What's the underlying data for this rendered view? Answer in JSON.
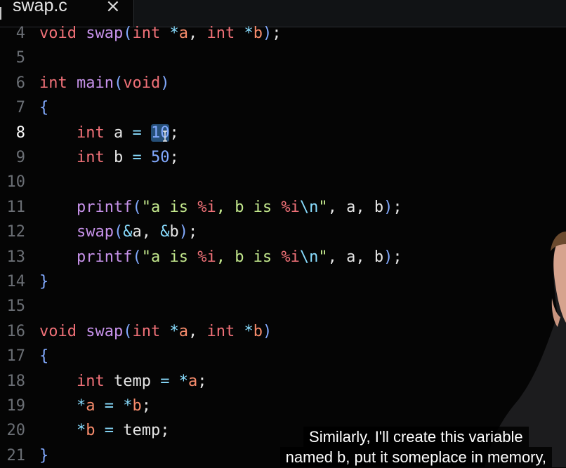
{
  "tab": {
    "label": "swap.c",
    "close_glyph": "×",
    "icon": "file-icon"
  },
  "active_line": "8",
  "lines": [
    {
      "n": "4",
      "tokens": [
        [
          "kw",
          "void"
        ],
        [
          "pl",
          " "
        ],
        [
          "fn",
          "swap"
        ],
        [
          "pn",
          "("
        ],
        [
          "kw",
          "int"
        ],
        [
          "pl",
          " "
        ],
        [
          "op",
          "*"
        ],
        [
          "vr",
          "a"
        ],
        [
          "pl",
          ", "
        ],
        [
          "kw",
          "int"
        ],
        [
          "pl",
          " "
        ],
        [
          "op",
          "*"
        ],
        [
          "vr",
          "b"
        ],
        [
          "pn",
          ")"
        ],
        [
          "pl",
          ";"
        ]
      ]
    },
    {
      "n": "5",
      "tokens": []
    },
    {
      "n": "6",
      "tokens": [
        [
          "kw",
          "int"
        ],
        [
          "pl",
          " "
        ],
        [
          "fn",
          "main"
        ],
        [
          "pn",
          "("
        ],
        [
          "kw",
          "void"
        ],
        [
          "pn",
          ")"
        ]
      ]
    },
    {
      "n": "7",
      "tokens": [
        [
          "pn",
          "{"
        ]
      ]
    },
    {
      "n": "8",
      "tokens": [
        [
          "pl",
          "    "
        ],
        [
          "kw",
          "int"
        ],
        [
          "pl",
          " a "
        ],
        [
          "op",
          "="
        ],
        [
          "pl",
          " "
        ],
        [
          "sel",
          "10"
        ],
        [
          "pl",
          ";"
        ]
      ]
    },
    {
      "n": "9",
      "tokens": [
        [
          "pl",
          "    "
        ],
        [
          "kw",
          "int"
        ],
        [
          "pl",
          " b "
        ],
        [
          "op",
          "="
        ],
        [
          "pl",
          " "
        ],
        [
          "nm",
          "50"
        ],
        [
          "pl",
          ";"
        ]
      ]
    },
    {
      "n": "10",
      "tokens": []
    },
    {
      "n": "11",
      "tokens": [
        [
          "pl",
          "    "
        ],
        [
          "fn",
          "printf"
        ],
        [
          "pn",
          "("
        ],
        [
          "st",
          "\"a is "
        ],
        [
          "fm",
          "%i"
        ],
        [
          "st",
          ", b is "
        ],
        [
          "fm",
          "%i"
        ],
        [
          "es",
          "\\n"
        ],
        [
          "st",
          "\""
        ],
        [
          "pl",
          ", a, b"
        ],
        [
          "pn",
          ")"
        ],
        [
          "pl",
          ";"
        ]
      ]
    },
    {
      "n": "12",
      "tokens": [
        [
          "pl",
          "    "
        ],
        [
          "fn",
          "swap"
        ],
        [
          "pn",
          "("
        ],
        [
          "op",
          "&"
        ],
        [
          "pl",
          "a, "
        ],
        [
          "op",
          "&"
        ],
        [
          "pl",
          "b"
        ],
        [
          "pn",
          ")"
        ],
        [
          "pl",
          ";"
        ]
      ]
    },
    {
      "n": "13",
      "tokens": [
        [
          "pl",
          "    "
        ],
        [
          "fn",
          "printf"
        ],
        [
          "pn",
          "("
        ],
        [
          "st",
          "\"a is "
        ],
        [
          "fm",
          "%i"
        ],
        [
          "st",
          ", b is "
        ],
        [
          "fm",
          "%i"
        ],
        [
          "es",
          "\\n"
        ],
        [
          "st",
          "\""
        ],
        [
          "pl",
          ", a, b"
        ],
        [
          "pn",
          ")"
        ],
        [
          "pl",
          ";"
        ]
      ]
    },
    {
      "n": "14",
      "tokens": [
        [
          "pn",
          "}"
        ]
      ]
    },
    {
      "n": "15",
      "tokens": []
    },
    {
      "n": "16",
      "tokens": [
        [
          "kw",
          "void"
        ],
        [
          "pl",
          " "
        ],
        [
          "fn",
          "swap"
        ],
        [
          "pn",
          "("
        ],
        [
          "kw",
          "int"
        ],
        [
          "pl",
          " "
        ],
        [
          "op",
          "*"
        ],
        [
          "vr",
          "a"
        ],
        [
          "pl",
          ", "
        ],
        [
          "kw",
          "int"
        ],
        [
          "pl",
          " "
        ],
        [
          "op",
          "*"
        ],
        [
          "vr",
          "b"
        ],
        [
          "pn",
          ")"
        ]
      ]
    },
    {
      "n": "17",
      "tokens": [
        [
          "pn",
          "{"
        ]
      ]
    },
    {
      "n": "18",
      "tokens": [
        [
          "pl",
          "    "
        ],
        [
          "kw",
          "int"
        ],
        [
          "pl",
          " temp "
        ],
        [
          "op",
          "="
        ],
        [
          "pl",
          " "
        ],
        [
          "op",
          "*"
        ],
        [
          "vr",
          "a"
        ],
        [
          "pl",
          ";"
        ]
      ]
    },
    {
      "n": "19",
      "tokens": [
        [
          "pl",
          "    "
        ],
        [
          "op",
          "*"
        ],
        [
          "vr",
          "a"
        ],
        [
          "pl",
          " "
        ],
        [
          "op",
          "="
        ],
        [
          "pl",
          " "
        ],
        [
          "op",
          "*"
        ],
        [
          "vr",
          "b"
        ],
        [
          "pl",
          ";"
        ]
      ]
    },
    {
      "n": "20",
      "tokens": [
        [
          "pl",
          "    "
        ],
        [
          "op",
          "*"
        ],
        [
          "vr",
          "b"
        ],
        [
          "pl",
          " "
        ],
        [
          "op",
          "="
        ],
        [
          "pl",
          " temp;"
        ]
      ]
    },
    {
      "n": "21",
      "tokens": [
        [
          "pn",
          "}"
        ]
      ]
    }
  ],
  "subtitle": {
    "line1": "Similarly, I'll create this variable",
    "line2": "named b, put it someplace in memory,"
  },
  "colors": {
    "background": "#050505",
    "keyword": "#f07178",
    "function": "#c792ea",
    "paren": "#82aaff",
    "pointer_var": "#f78c6c",
    "operator": "#89ddff",
    "string": "#c3e88d",
    "selection": "#264f78"
  }
}
